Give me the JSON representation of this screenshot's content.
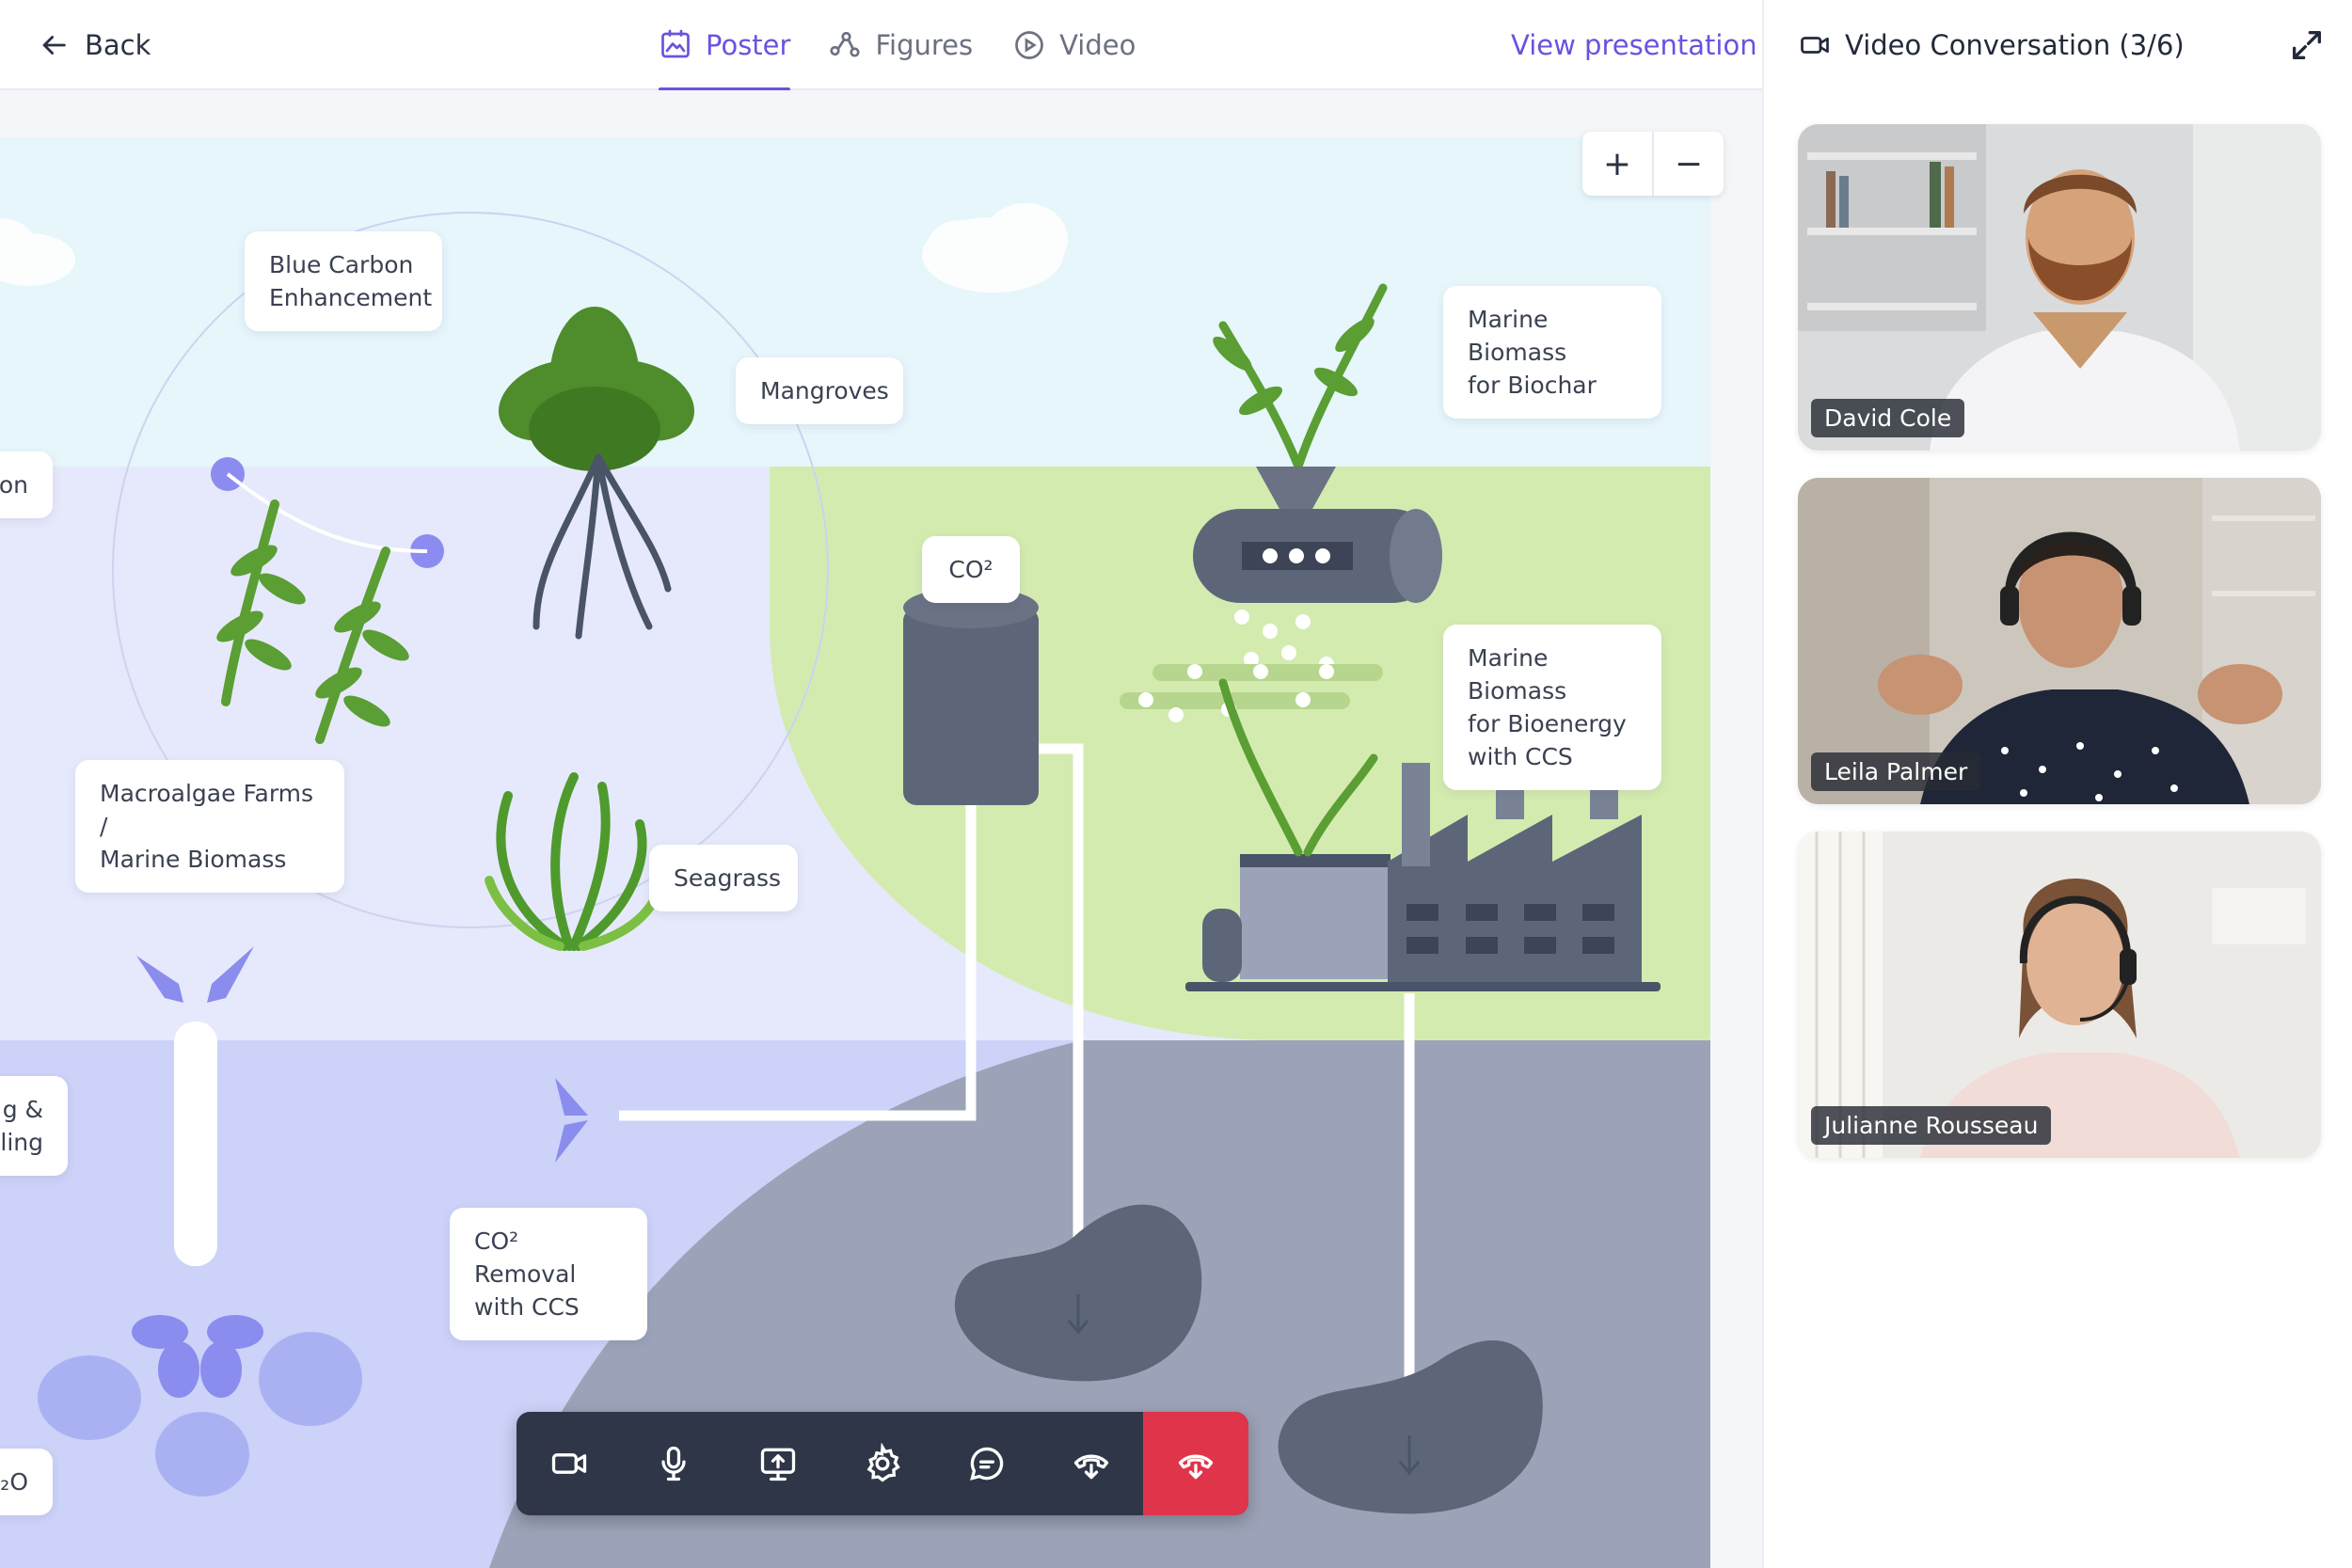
{
  "nav": {
    "back_label": "Back",
    "tabs": [
      {
        "label": "Poster",
        "active": true
      },
      {
        "label": "Figures",
        "active": false
      },
      {
        "label": "Video",
        "active": false
      }
    ],
    "view_presentation": "View presentation"
  },
  "video_panel": {
    "title": "Video Conversation (3/6)",
    "participants": [
      {
        "name": "David Cole"
      },
      {
        "name": "Leila Palmer"
      },
      {
        "name": "Julianne Rousseau"
      }
    ]
  },
  "poster": {
    "labels": {
      "blue_carbon": "Blue Carbon\nEnhancement",
      "mangroves": "Mangroves",
      "marine_biochar": "Marine Biomass\nfor Biochar",
      "co2": "CO²",
      "marine_bioenergy": "Marine Biomass\nfor Bioenergy\nwith CCS",
      "macroalgae": "Macroalgae Farms /\nMarine Biomass",
      "seagrass": "Seagrass",
      "co2_removal": "CO² Removal\nwith CCS",
      "partial_left_1": "on",
      "partial_left_2": "g &\nlling",
      "partial_left_3": "₂O"
    }
  },
  "zoom": {
    "plus": "+",
    "minus": "−"
  },
  "colors": {
    "accent": "#6a52e0",
    "end_call": "#e0344a",
    "toolbar": "#2e3647"
  }
}
